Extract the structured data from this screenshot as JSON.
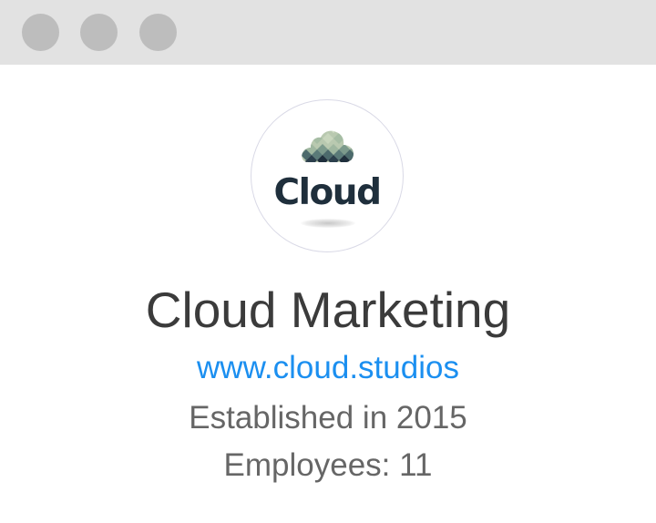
{
  "window": {
    "controls": [
      "close",
      "minimize",
      "maximize"
    ],
    "control_color": "#bdbdbd",
    "titlebar_color": "#e2e2e2"
  },
  "logo": {
    "wordmark": "Cloud",
    "icon": "cloud-icon",
    "colors": {
      "dark": "#1f2f3c",
      "mid": "#5a7a78",
      "light": "#b9c9b0"
    }
  },
  "company": {
    "name": "Cloud Marketing",
    "website": "www.cloud.studios",
    "established": "Established in 2015",
    "employees": "Employees: 11"
  },
  "colors": {
    "link": "#1b8ff0",
    "heading": "#3b3b3b",
    "body_text": "#666666"
  }
}
